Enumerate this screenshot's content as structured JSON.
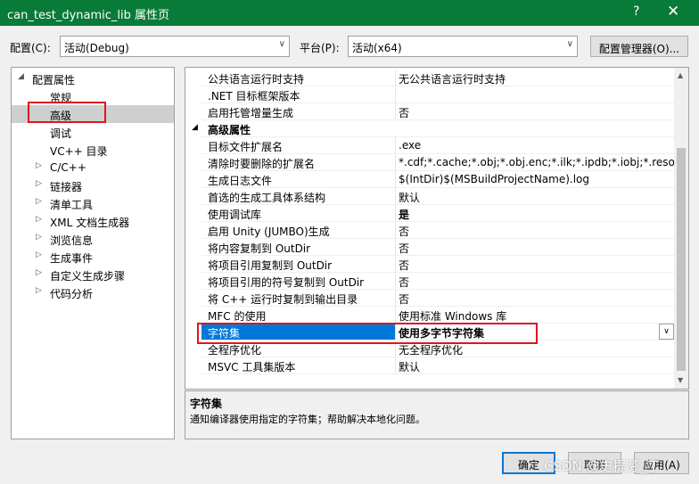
{
  "window": {
    "title": "can_test_dynamic_lib 属性页",
    "help": "?",
    "close": "✕"
  },
  "toolbar": {
    "config_label": "配置(C):",
    "config_value": "活动(Debug)",
    "platform_label": "平台(P):",
    "platform_value": "活动(x64)",
    "config_manager": "配置管理器(O)..."
  },
  "tree": {
    "items": [
      {
        "label": "配置属性",
        "expander": "◢"
      },
      {
        "label": "常规",
        "expander": ""
      },
      {
        "label": "高级",
        "expander": ""
      },
      {
        "label": "调试",
        "expander": ""
      },
      {
        "label": "VC++ 目录",
        "expander": ""
      },
      {
        "label": "C/C++",
        "expander": "▷"
      },
      {
        "label": "链接器",
        "expander": "▷"
      },
      {
        "label": "清单工具",
        "expander": "▷"
      },
      {
        "label": "XML 文档生成器",
        "expander": "▷"
      },
      {
        "label": "浏览信息",
        "expander": "▷"
      },
      {
        "label": "生成事件",
        "expander": "▷"
      },
      {
        "label": "自定义生成步骤",
        "expander": "▷"
      },
      {
        "label": "代码分析",
        "expander": "▷"
      }
    ]
  },
  "grid": {
    "rows": [
      {
        "name": "公共语言运行时支持",
        "value": "无公共语言运行时支持"
      },
      {
        "name": ".NET 目标框架版本",
        "value": ""
      },
      {
        "name": "启用托管增量生成",
        "value": "否"
      },
      {
        "name": "高级属性",
        "value": "",
        "section": true,
        "expander": "◢"
      },
      {
        "name": "目标文件扩展名",
        "value": ".exe"
      },
      {
        "name": "清除时要删除的扩展名",
        "value": "*.cdf;*.cache;*.obj;*.obj.enc;*.ilk;*.ipdb;*.iobj;*.resources;*.tlb"
      },
      {
        "name": "生成日志文件",
        "value": "$(IntDir)$(MSBuildProjectName).log"
      },
      {
        "name": "首选的生成工具体系结构",
        "value": "默认"
      },
      {
        "name": "使用调试库",
        "value": "是",
        "bold": true
      },
      {
        "name": "启用 Unity (JUMBO)生成",
        "value": "否"
      },
      {
        "name": "将内容复制到 OutDir",
        "value": "否"
      },
      {
        "name": "将项目引用复制到 OutDir",
        "value": "否"
      },
      {
        "name": "将项目引用的符号复制到 OutDir",
        "value": "否"
      },
      {
        "name": "将 C++ 运行时复制到输出目录",
        "value": "否"
      },
      {
        "name": "MFC 的使用",
        "value": "使用标准 Windows 库"
      },
      {
        "name": "字符集",
        "value": "使用多字节字符集",
        "selected": true,
        "dropdown": "∨"
      },
      {
        "name": "全程序优化",
        "value": "无全程序优化"
      },
      {
        "name": "MSVC 工具集版本",
        "value": "默认"
      }
    ]
  },
  "description": {
    "title": "字符集",
    "text": "通知编译器使用指定的字符集；帮助解决本地化问题。"
  },
  "buttons": {
    "ok": "确定",
    "cancel": "取消",
    "apply": "应用(A)"
  },
  "watermark": "CSDN @史提芬_丁",
  "colors": {
    "titlebar": "#087b38",
    "selection": "#0078d7",
    "highlight_box": "#e0141e"
  }
}
